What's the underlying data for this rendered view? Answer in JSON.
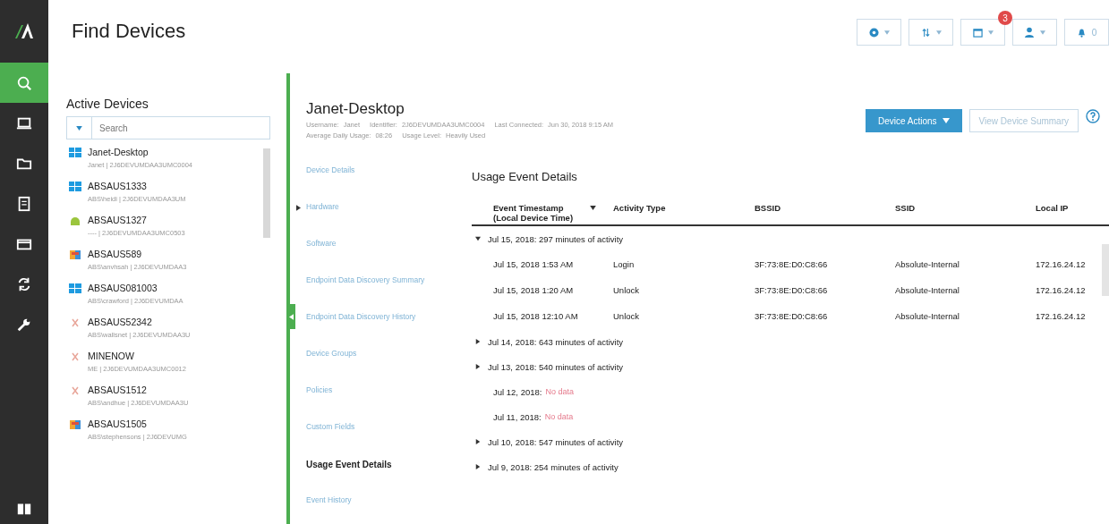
{
  "page_title": "Find Devices",
  "rail": [
    {
      "selected": true
    },
    {
      "selected": false
    },
    {
      "selected": false
    },
    {
      "selected": false
    },
    {
      "selected": false
    },
    {
      "selected": false
    },
    {
      "selected": false
    }
  ],
  "toolbar": {
    "calendar_badge": "3",
    "notification_count": "0"
  },
  "device_list": {
    "title": "Active Devices",
    "search": {
      "placeholder": "Search"
    },
    "items": [
      {
        "name": "Janet-Desktop",
        "subtitle": "Janet | 2J6DEVUMDAA3UMC0004",
        "kind": "windows",
        "selected": false
      },
      {
        "name": "ABSAUS1333",
        "subtitle": "ABS\\heidi | 2J6DEVUMDAA3UM",
        "kind": "windows",
        "selected": false
      },
      {
        "name": "ABSAUS1327",
        "subtitle": "---- | 2J6DEVUMDAA3UMC0503",
        "kind": "android",
        "selected": false
      },
      {
        "name": "ABSAUS589",
        "subtitle": "ABS\\anvhsah | 2J6DEVUMDAA3",
        "kind": "mac",
        "selected": false
      },
      {
        "name": "ABSAUS081003",
        "subtitle": "ABS\\crawford | 2J6DEVUMDAA",
        "kind": "windows",
        "selected": false
      },
      {
        "name": "ABSAUS52342",
        "subtitle": "ABS\\wallsnet | 2J6DEVUMDAA3U",
        "kind": "other",
        "selected": false
      },
      {
        "name": "MINENOW",
        "subtitle": "ME | 2J6DEVUMDAA3UMC0012",
        "kind": "other",
        "selected": false
      },
      {
        "name": "ABSAUS1512",
        "subtitle": "ABS\\andhue | 2J6DEVUMDAA3U",
        "kind": "other",
        "selected": false
      },
      {
        "name": "ABSAUS1505",
        "subtitle": "ABS\\stephensons | 2J6DEVUMG",
        "kind": "mac",
        "selected": false
      }
    ]
  },
  "device": {
    "name": "Janet-Desktop",
    "info_lines": [
      [
        {
          "label": "Username:",
          "value": "Janet"
        },
        {
          "label": "Identifier:",
          "value": "2J6DEVUMDAA3UMC0004"
        },
        {
          "label": "Last Connected:",
          "value": "Jun 30, 2018 9:15 AM"
        }
      ],
      [
        {
          "label": "Average Daily Usage:",
          "value": "08:26"
        },
        {
          "label": "Usage Level:",
          "value": "Heavily Used"
        }
      ]
    ],
    "actions": [
      {
        "label": "Device Actions",
        "kind": "primary"
      },
      {
        "label": "View Device Summary",
        "kind": "secondary"
      }
    ]
  },
  "sections": [
    {
      "label": "Device Details",
      "expandable": false,
      "selected": false
    },
    {
      "label": "Hardware",
      "expandable": true,
      "selected": false
    },
    {
      "label": "Software",
      "expandable": false,
      "selected": false
    },
    {
      "label": "Endpoint Data Discovery Summary",
      "expandable": false,
      "selected": false
    },
    {
      "label": "Endpoint Data Discovery History",
      "expandable": false,
      "selected": false
    },
    {
      "label": "Device Groups",
      "expandable": false,
      "selected": false
    },
    {
      "label": "Policies",
      "expandable": false,
      "selected": false
    },
    {
      "label": "Custom Fields",
      "expandable": false,
      "selected": false
    },
    {
      "label": "Usage Event Details",
      "expandable": false,
      "selected": true
    },
    {
      "label": "Event History",
      "expandable": false,
      "selected": false
    }
  ],
  "usage": {
    "title": "Usage Event Details",
    "columns": [
      {
        "label": "Event Timestamp (Local Device Time)",
        "sorted": true
      },
      {
        "label": "Activity Type",
        "sorted": false
      },
      {
        "label": "BSSID",
        "sorted": false
      },
      {
        "label": "SSID",
        "sorted": false
      },
      {
        "label": "Local IP",
        "sorted": false
      }
    ],
    "days": [
      {
        "kind": "activity",
        "date": "Jul 15, 2018:",
        "summary": "297 minutes of activity",
        "expanded": true,
        "rows": [
          [
            "Jul 15, 2018 1:53 AM",
            "Login",
            "3F:73:8E:D0:C8:66",
            "Absolute-Internal",
            "172.16.24.12"
          ],
          [
            "Jul 15, 2018 1:20 AM",
            "Unlock",
            "3F:73:8E:D0:C8:66",
            "Absolute-Internal",
            "172.16.24.12"
          ],
          [
            "Jul 15, 2018 12:10 AM",
            "Unlock",
            "3F:73:8E:D0:C8:66",
            "Absolute-Internal",
            "172.16.24.12"
          ]
        ]
      },
      {
        "kind": "activity",
        "date": "Jul 14, 2018:",
        "summary": "643 minutes of activity",
        "expanded": false
      },
      {
        "kind": "activity",
        "date": "Jul 13, 2018:",
        "summary": "540 minutes of activity",
        "expanded": false
      },
      {
        "kind": "empty",
        "date": "Jul 12, 2018:",
        "summary": "No data"
      },
      {
        "kind": "empty",
        "date": "Jul 11, 2018:",
        "summary": "No data"
      },
      {
        "kind": "activity",
        "date": "Jul 10, 2018:",
        "summary": "547 minutes of activity",
        "expanded": false
      },
      {
        "kind": "activity",
        "date": "Jul 9, 2018:",
        "summary": "254 minutes of activity",
        "expanded": false
      }
    ]
  }
}
